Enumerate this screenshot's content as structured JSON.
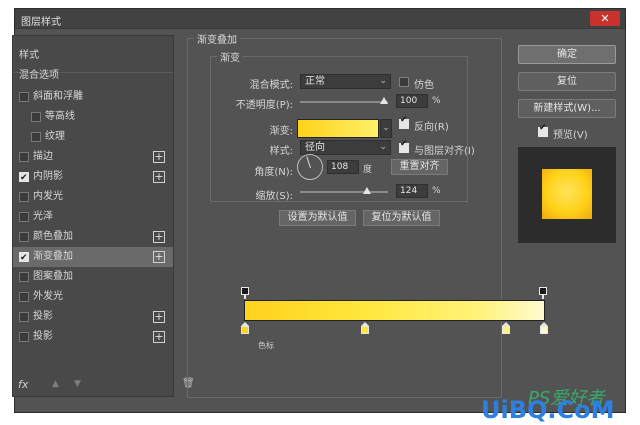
{
  "window": {
    "title": "图层样式",
    "close_icon": "close-icon"
  },
  "left_panel": {
    "items": [
      {
        "label": "样式",
        "checkbox": false,
        "checked": false,
        "plus": false,
        "selected": false,
        "indent": 0
      },
      {
        "label": "混合选项",
        "checkbox": false,
        "checked": false,
        "plus": false,
        "selected": false,
        "indent": 0
      },
      {
        "label": "斜面和浮雕",
        "checkbox": true,
        "checked": false,
        "plus": false,
        "selected": false,
        "indent": 0
      },
      {
        "label": "等高线",
        "checkbox": true,
        "checked": false,
        "plus": false,
        "selected": false,
        "indent": 1
      },
      {
        "label": "纹理",
        "checkbox": true,
        "checked": false,
        "plus": false,
        "selected": false,
        "indent": 1
      },
      {
        "label": "描边",
        "checkbox": true,
        "checked": false,
        "plus": true,
        "selected": false,
        "indent": 0
      },
      {
        "label": "内阴影",
        "checkbox": true,
        "checked": true,
        "plus": true,
        "selected": false,
        "indent": 0
      },
      {
        "label": "内发光",
        "checkbox": true,
        "checked": false,
        "plus": false,
        "selected": false,
        "indent": 0
      },
      {
        "label": "光泽",
        "checkbox": true,
        "checked": false,
        "plus": false,
        "selected": false,
        "indent": 0
      },
      {
        "label": "颜色叠加",
        "checkbox": true,
        "checked": false,
        "plus": true,
        "selected": false,
        "indent": 0
      },
      {
        "label": "渐变叠加",
        "checkbox": true,
        "checked": true,
        "plus": true,
        "selected": true,
        "indent": 0
      },
      {
        "label": "图案叠加",
        "checkbox": true,
        "checked": false,
        "plus": false,
        "selected": false,
        "indent": 0
      },
      {
        "label": "外发光",
        "checkbox": true,
        "checked": false,
        "plus": false,
        "selected": false,
        "indent": 0
      },
      {
        "label": "投影",
        "checkbox": true,
        "checked": false,
        "plus": true,
        "selected": false,
        "indent": 0
      },
      {
        "label": "投影",
        "checkbox": true,
        "checked": false,
        "plus": true,
        "selected": false,
        "indent": 0
      }
    ],
    "footer": {
      "fx_label": "fx",
      "up_icon": "arrow-up-icon",
      "down_icon": "arrow-down-icon",
      "trash_icon": "trash-icon"
    }
  },
  "gradient_overlay": {
    "group_title": "渐变叠加",
    "subgroup_title": "渐变",
    "blend_mode_label": "混合模式:",
    "blend_mode_value": "正常",
    "dither_label": "仿色",
    "dither_checked": false,
    "opacity_label": "不透明度(P):",
    "opacity_value": "100",
    "opacity_unit": "%",
    "gradient_label": "渐变:",
    "reverse_label": "反向(R)",
    "reverse_checked": true,
    "style_label": "样式:",
    "style_value": "径向",
    "align_label": "与图层对齐(I)",
    "align_checked": true,
    "angle_label": "角度(N):",
    "angle_value": "108",
    "angle_unit": "度",
    "reset_align_button": "重置对齐",
    "scale_label": "缩放(S):",
    "scale_value": "124",
    "scale_unit": "%",
    "make_default_button": "设置为默认值",
    "reset_default_button": "复位为默认值"
  },
  "gradient_editor": {
    "colors": [
      "#ffd21d",
      "#ffe63a",
      "#fff37a",
      "#fffbd0"
    ],
    "small_text": "色标"
  },
  "right_panel": {
    "ok_button": "确定",
    "reset_button": "复位",
    "new_style_button": "新建样式(W)...",
    "preview_label": "预览(V)",
    "preview_checked": true
  },
  "watermark": {
    "line1": "PS爱好者",
    "line2": "UiBQ.CoM"
  }
}
